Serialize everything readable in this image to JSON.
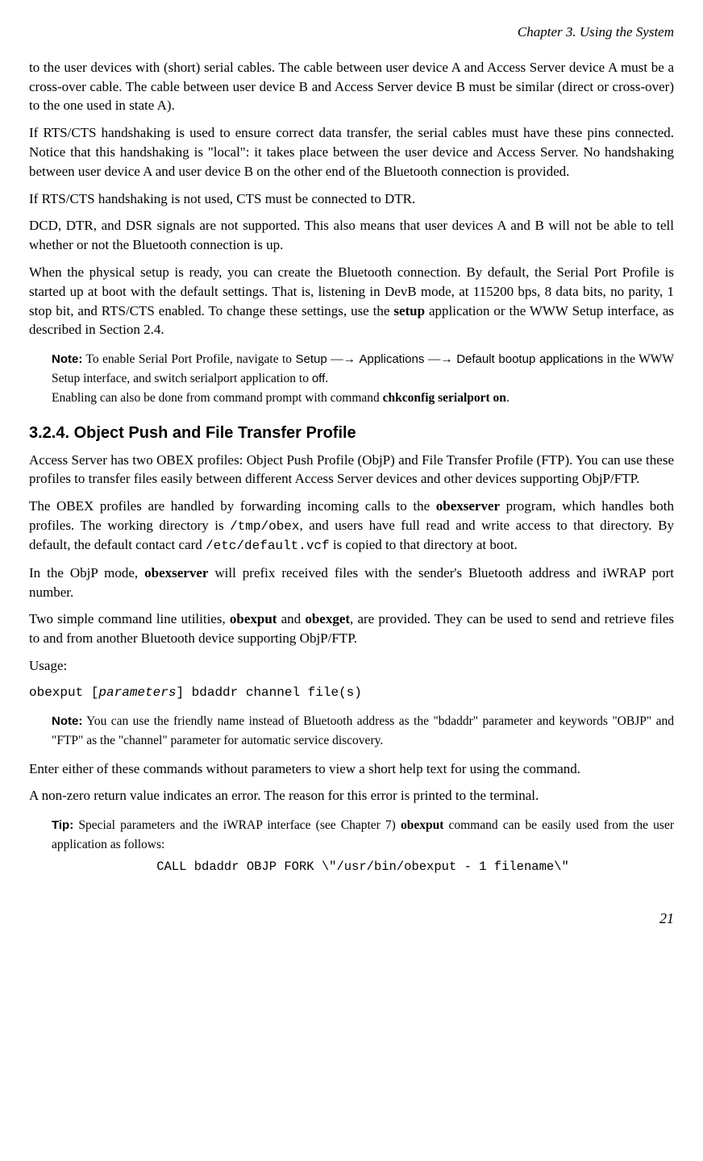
{
  "header": {
    "chapter": "Chapter 3. Using the System"
  },
  "paragraphs": {
    "p1": "to the user devices with (short) serial cables. The cable between user device A and Access Server device A must be a cross-over cable. The cable between user device B and Access Server device B must be similar (direct or cross-over) to the one used in state A).",
    "p2": "If RTS/CTS handshaking is used to ensure correct data transfer, the serial cables must have these pins connected. Notice that this handshaking is \"local\": it takes place between the user device and Access Server. No handshaking between user device A and user device B on the other end of the Bluetooth connection is provided.",
    "p3": "If RTS/CTS handshaking is not used, CTS must be connected to DTR.",
    "p4": "DCD, DTR, and DSR signals are not supported. This also means that user devices A and B will not be able to tell whether or not the Bluetooth connection is up.",
    "p5a": "When the physical setup is ready, you can create the Bluetooth connection. By default, the Serial Port Profile is started up at boot with the default settings. That is, listening in DevB mode, at 115200 bps, 8 data bits, no parity, 1 stop bit, and RTS/CTS enabled. To change these settings, use the ",
    "p5_bold": "setup",
    "p5b": " application or the WWW Setup interface, as described in Section 2.4.",
    "note1": {
      "label": "Note:",
      "t1": " To enable Serial Port Profile, navigate to ",
      "nav1": "Setup",
      "arrow": " —→ ",
      "nav2": "Applications",
      "nav3": "Default bootup applications",
      "t2": " in the WWW Setup interface, and switch serialport application to ",
      "off": "off",
      "t3": ".",
      "line2a": "Enabling can also be done from command prompt with command ",
      "line2b": "chkconfig serialport on",
      "line2c": "."
    },
    "heading": "3.2.4. Object Push and File Transfer Profile",
    "p6": "Access Server has two OBEX profiles: Object Push Profile (ObjP) and File Transfer Profile (FTP). You can use these profiles to transfer files easily between different Access Server devices and other devices supporting ObjP/FTP.",
    "p7a": "The OBEX profiles are handled by forwarding incoming calls to the ",
    "p7_bold1": "obexserver",
    "p7b": " program, which handles both profiles. The working directory is ",
    "p7_mono1": "/tmp/obex",
    "p7c": ", and users have full read and write access to that directory. By default, the default contact card ",
    "p7_mono2": "/etc/default.vcf",
    "p7d": " is copied to that directory at boot.",
    "p8a": "In the ObjP mode, ",
    "p8_bold": "obexserver",
    "p8b": " will prefix received files with the sender's Bluetooth address and iWRAP port number.",
    "p9a": "Two simple command line utilities, ",
    "p9_bold1": "obexput",
    "p9b": " and ",
    "p9_bold2": "obexget",
    "p9c": ", are provided. They can be used to send and retrieve files to and from another Bluetooth device supporting ObjP/FTP.",
    "usage_label": "Usage:",
    "usage_cmd1": "obexput [",
    "usage_param": "parameters",
    "usage_cmd2": "] bdaddr channel file(s)",
    "note2": {
      "label": "Note:",
      "text": " You can use the friendly name instead of Bluetooth address as the \"bdaddr\" parameter and keywords \"OBJP\" and \"FTP\" as the \"channel\" parameter for automatic service discovery."
    },
    "p10": "Enter either of these commands without parameters to view a short help text for using the command.",
    "p11": "A non-zero return value indicates an error. The reason for this error is printed to the terminal.",
    "tip": {
      "label": "Tip:",
      "t1": " Special parameters and the iWRAP interface (see Chapter 7) ",
      "bold": "obexput",
      "t2": " command can be easily used from the user application as follows:",
      "code": "CALL bdaddr OBJP FORK \\\"/usr/bin/obexput - 1 filename\\\""
    }
  },
  "page_number": "21"
}
